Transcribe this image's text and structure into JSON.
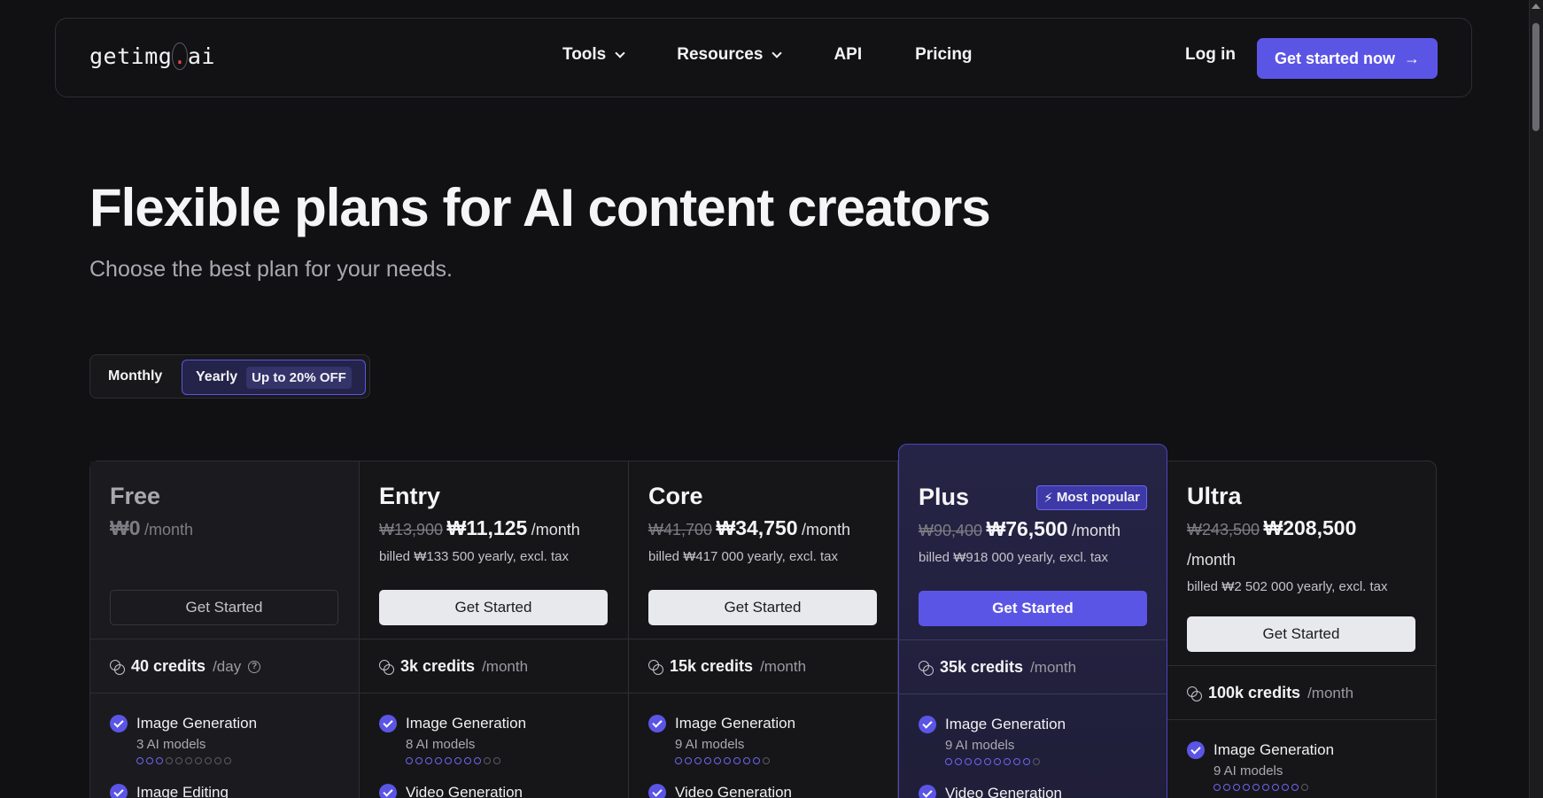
{
  "header": {
    "logo_main": "getimg",
    "logo_dot": ".",
    "logo_tld": "ai",
    "nav": [
      {
        "label": "Tools",
        "has_dropdown": true
      },
      {
        "label": "Resources",
        "has_dropdown": true
      },
      {
        "label": "API",
        "has_dropdown": false
      },
      {
        "label": "Pricing",
        "has_dropdown": false
      }
    ],
    "login_label": "Log in",
    "cta_label": "Get started now",
    "cta_icon": "arrow-right-icon"
  },
  "hero": {
    "title": "Flexible plans for AI content creators",
    "subtitle": "Choose the best plan for your needs."
  },
  "billing_toggle": {
    "monthly_label": "Monthly",
    "yearly_label": "Yearly",
    "yearly_badge": "Up to 20% OFF",
    "selected": "Yearly"
  },
  "plans": [
    {
      "name": "Free",
      "old_price": "",
      "price": "₩0",
      "unit": "/month",
      "billed": "",
      "button": "Get Started",
      "credits": "40 credits",
      "credits_unit": "/day",
      "feature_1": "Image Generation",
      "feature_1_sub": "3 AI models",
      "feature_1_models": 3,
      "feature_2": "Image Editing"
    },
    {
      "name": "Entry",
      "old_price": "₩13,900",
      "price": "₩11,125",
      "unit": "/month",
      "billed": "billed ₩133 500 yearly, excl. tax",
      "button": "Get Started",
      "credits": "3k credits",
      "credits_unit": "/month",
      "feature_1": "Image Generation",
      "feature_1_sub": "8 AI models",
      "feature_1_models": 8,
      "feature_2": "Video Generation"
    },
    {
      "name": "Core",
      "old_price": "₩41,700",
      "price": "₩34,750",
      "unit": "/month",
      "billed": "billed ₩417 000 yearly, excl. tax",
      "button": "Get Started",
      "credits": "15k credits",
      "credits_unit": "/month",
      "feature_1": "Image Generation",
      "feature_1_sub": "9 AI models",
      "feature_1_models": 9,
      "feature_2": "Video Generation"
    },
    {
      "name": "Plus",
      "badge": "Most popular",
      "old_price": "₩90,400",
      "price": "₩76,500",
      "unit": "/month",
      "billed": "billed ₩918 000 yearly, excl. tax",
      "button": "Get Started",
      "credits": "35k credits",
      "credits_unit": "/month",
      "feature_1": "Image Generation",
      "feature_1_sub": "9 AI models",
      "feature_1_models": 9,
      "feature_2": "Video Generation"
    },
    {
      "name": "Ultra",
      "old_price": "₩243,500",
      "price": "₩208,500",
      "unit": "/month",
      "billed": "billed ₩2 502 000 yearly, excl. tax",
      "button": "Get Started",
      "credits": "100k credits",
      "credits_unit": "/month",
      "feature_1": "Image Generation",
      "feature_1_sub": "9 AI models",
      "feature_1_models": 9
    }
  ],
  "model_dots_total": 10,
  "colors": {
    "accent": "#5b55e6",
    "background": "#111114",
    "logo_dot": "#e5484d"
  }
}
